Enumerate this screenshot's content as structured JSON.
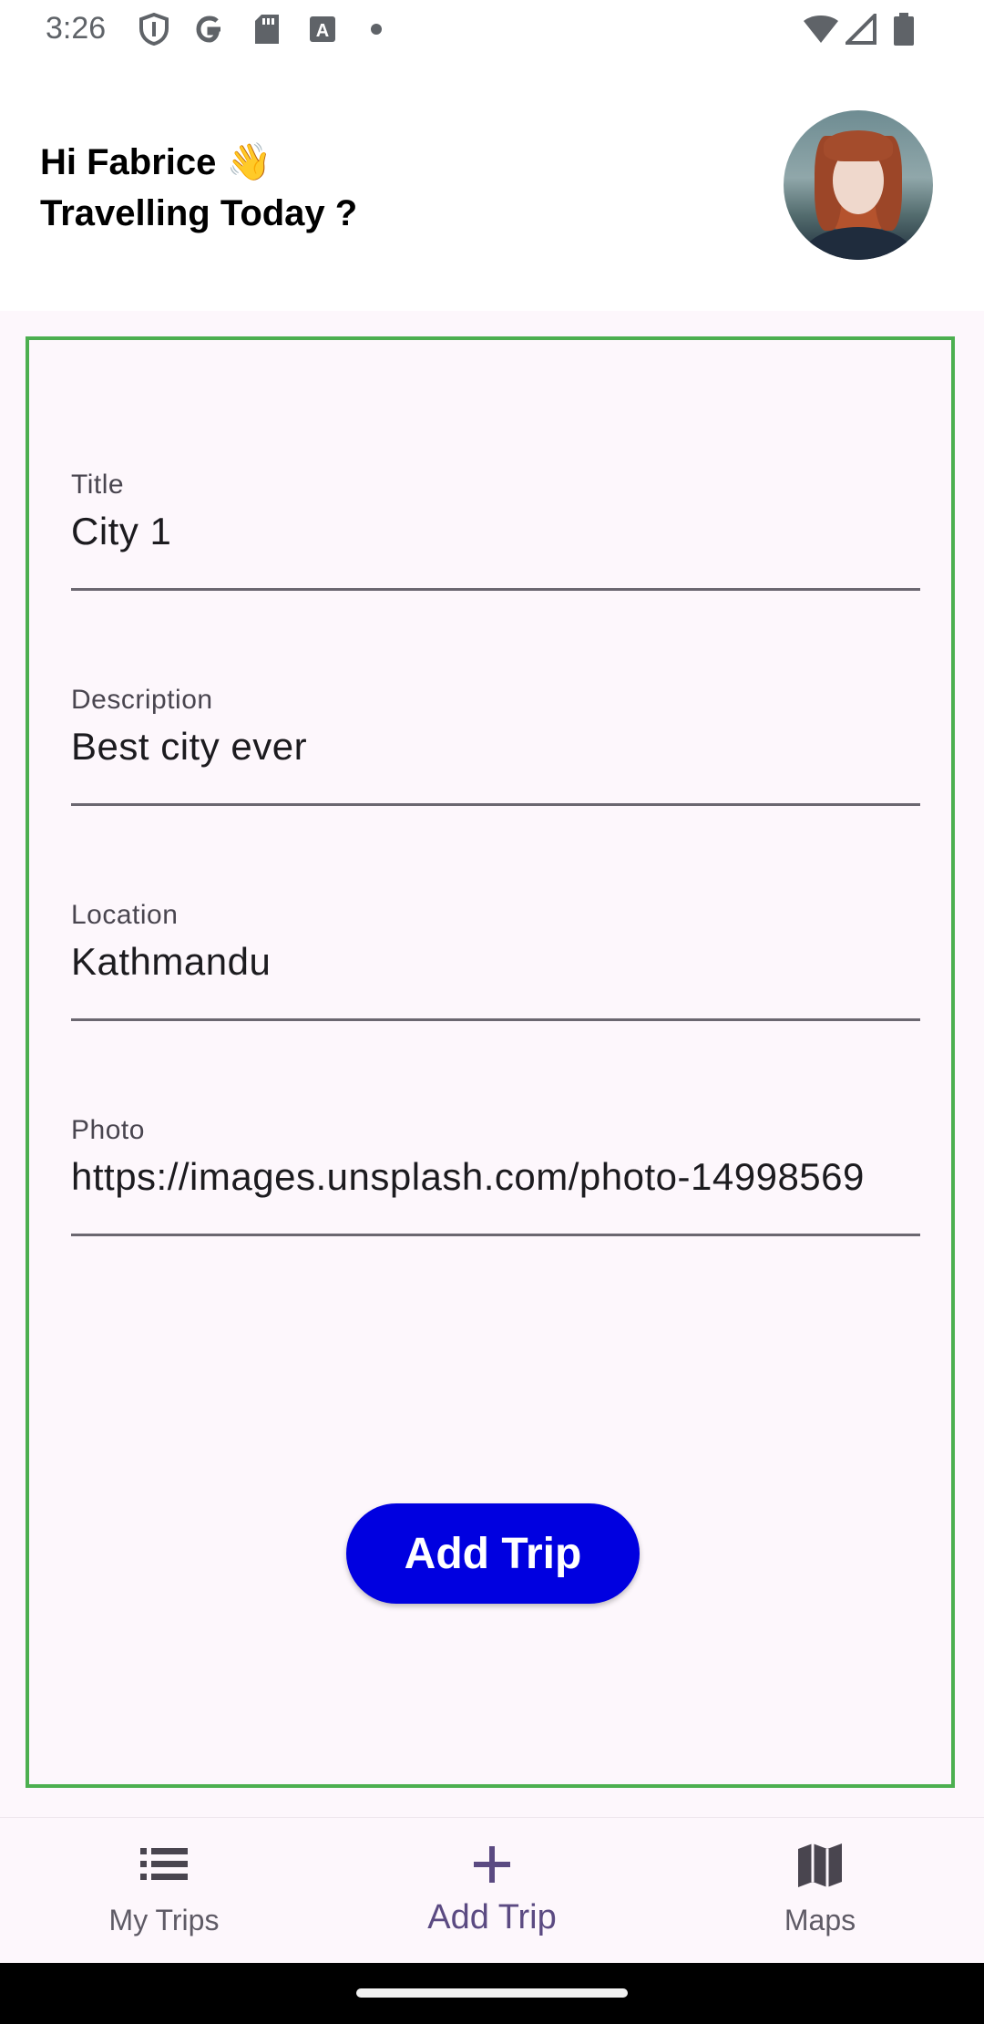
{
  "status_bar": {
    "time": "3:26",
    "icons": [
      "shield-icon",
      "google-icon",
      "sd-card-icon",
      "text-icon",
      "dot-icon",
      "wifi-icon",
      "signal-icon",
      "battery-icon"
    ]
  },
  "header": {
    "greeting_line1": "Hi Fabrice",
    "wave_emoji": "👋",
    "greeting_line2": "Travelling Today ?"
  },
  "form": {
    "title": {
      "label": "Title",
      "value": "City 1"
    },
    "description": {
      "label": "Description",
      "value": "Best city ever"
    },
    "location": {
      "label": "Location",
      "value": "Kathmandu"
    },
    "photo": {
      "label": "Photo",
      "value": "https://images.unsplash.com/photo-14998569"
    },
    "submit_label": "Add Trip",
    "border_color": "#4caf50",
    "button_color": "#0000e0"
  },
  "bottom_nav": {
    "items": [
      {
        "label": "My Trips",
        "icon": "list-icon",
        "active": false
      },
      {
        "label": "Add Trip",
        "icon": "plus-icon",
        "active": true
      },
      {
        "label": "Maps",
        "icon": "map-icon",
        "active": false
      }
    ]
  }
}
